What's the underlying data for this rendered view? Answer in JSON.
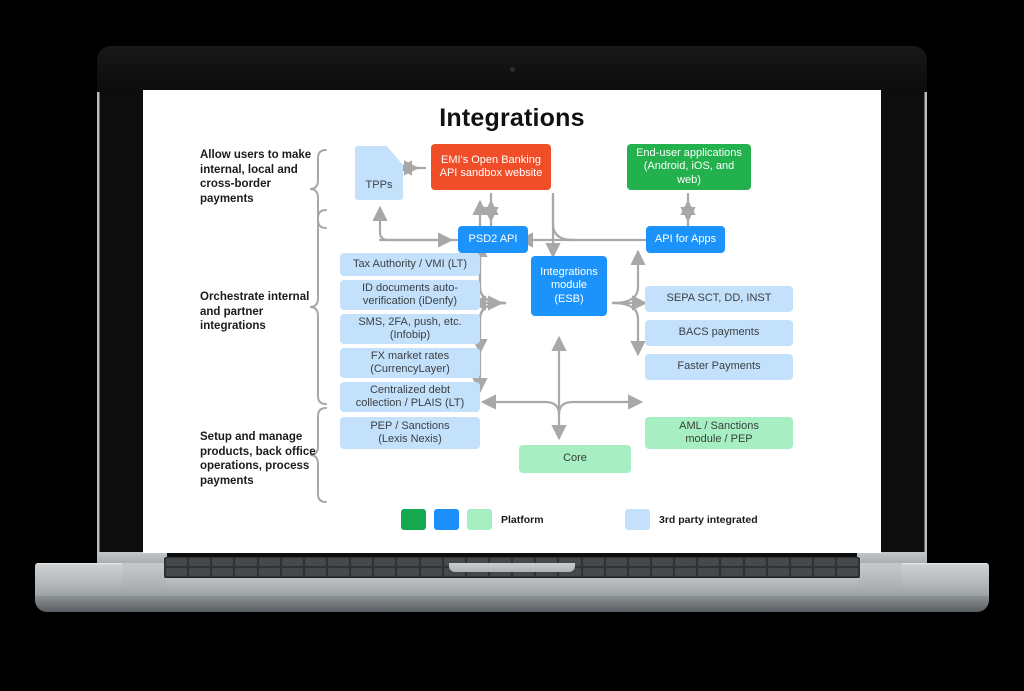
{
  "slide": {
    "title": "Integrations",
    "side_labels": [
      {
        "id": "grp-payments",
        "text": "Allow users to make internal, local and cross-border payments"
      },
      {
        "id": "grp-orchestrate",
        "text": "Orchestrate internal and partner integrations"
      },
      {
        "id": "grp-setup",
        "text": "Setup and manage products, back office operations, process payments"
      }
    ],
    "nodes": {
      "tpps": {
        "label": "TPPs",
        "color": "#c3e1fb"
      },
      "emi_sandbox": {
        "label": "EMI's Open Banking API sandbox website",
        "color": "#f04e28"
      },
      "end_user": {
        "label": "End-user applications (Android, iOS, and web)",
        "color": "#22b14c"
      },
      "psd2_api": {
        "label": "PSD2 API",
        "color": "#1b93fb"
      },
      "api_apps": {
        "label": "API for Apps",
        "color": "#1b93fb"
      },
      "esb": {
        "label": "Integrations module (ESB)",
        "color": "#1b93fb"
      },
      "core": {
        "label": "Core",
        "color": "#a7eec2"
      },
      "aml": {
        "label": "AML / Sanctions module / PEP",
        "color": "#a7eec2"
      }
    },
    "left_stack": [
      {
        "id": "tax-authority",
        "line1": "Tax Authority / VMI (LT)",
        "line2": ""
      },
      {
        "id": "id-documents",
        "line1": "ID documents auto-",
        "line2": "verification (iDenfy)"
      },
      {
        "id": "sms-2fa",
        "line1": "SMS, 2FA, push, etc.",
        "line2": "(Infobip)"
      },
      {
        "id": "fx-rates",
        "line1": "FX market rates",
        "line2": "(CurrencyLayer)"
      },
      {
        "id": "debt-collection",
        "line1": "Centralized debt",
        "line2": "collection / PLAIS (LT)"
      },
      {
        "id": "pep-sanctions",
        "line1": "PEP / Sanctions",
        "line2": "(Lexis Nexis)"
      }
    ],
    "right_stack": [
      {
        "id": "sepa",
        "line1": "SEPA SCT, DD, INST",
        "line2": ""
      },
      {
        "id": "bacs",
        "line1": "BACS payments",
        "line2": ""
      },
      {
        "id": "faster",
        "line1": "Faster Payments",
        "line2": ""
      }
    ],
    "esb_lines": [
      "Integrations",
      "module",
      "(ESB)"
    ],
    "emi_lines": [
      "EMI's Open Banking",
      "API sandbox website"
    ],
    "enduser_lines": [
      "End-user applications",
      "(Android, iOS, and web)"
    ],
    "aml_lines": [
      "AML / Sanctions",
      "module / PEP"
    ],
    "legend": {
      "platform_label": "Platform",
      "third_party_label": "3rd party integrated",
      "platform_swatches": [
        "#14a94f",
        "#1b8ffb",
        "#a7eec2"
      ],
      "third_party_swatch": "#c3e1fb"
    },
    "palette": {
      "blue": "#1b93fb",
      "light_blue": "#c3e1fb",
      "green": "#22b14c",
      "light_green": "#a7eec2",
      "orange": "#f04e28",
      "arrow_gray": "#a8a8a8"
    }
  }
}
